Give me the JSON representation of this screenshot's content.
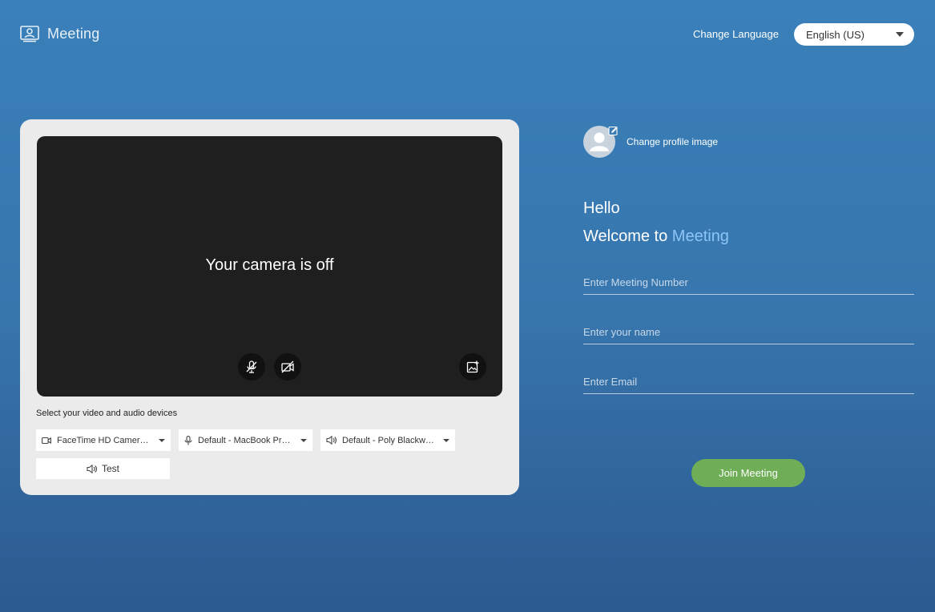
{
  "header": {
    "app_title": "Meeting",
    "logo_icon": "meeting-logo-icon",
    "change_language_label": "Change Language",
    "language_selected": "English (US)"
  },
  "preview": {
    "camera_status": "Your camera is off",
    "devices_label": "Select your video and audio devices",
    "camera_device": "FaceTime HD Camer…",
    "microphone_device": "Default - MacBook Pr…",
    "speaker_device": "Default - Poly Blackw…",
    "test_label": "Test",
    "icons": {
      "mic": "mic-muted-icon",
      "camera": "camera-off-icon",
      "background": "background-effects-icon",
      "speaker": "speaker-icon"
    }
  },
  "profile": {
    "change_image_label": "Change profile image"
  },
  "join_form": {
    "greeting": "Hello",
    "welcome_prefix": "Welcome to ",
    "welcome_app": "Meeting",
    "meeting_number_placeholder": "Enter Meeting Number",
    "name_placeholder": "Enter your name",
    "email_placeholder": "Enter Email",
    "join_label": "Join Meeting"
  },
  "colors": {
    "background_top": "#3a80ba",
    "background_bottom": "#2b5a90",
    "accent": "#8cc4f5",
    "join_button": "#6fae56",
    "video_bg": "#1f1f1f"
  }
}
